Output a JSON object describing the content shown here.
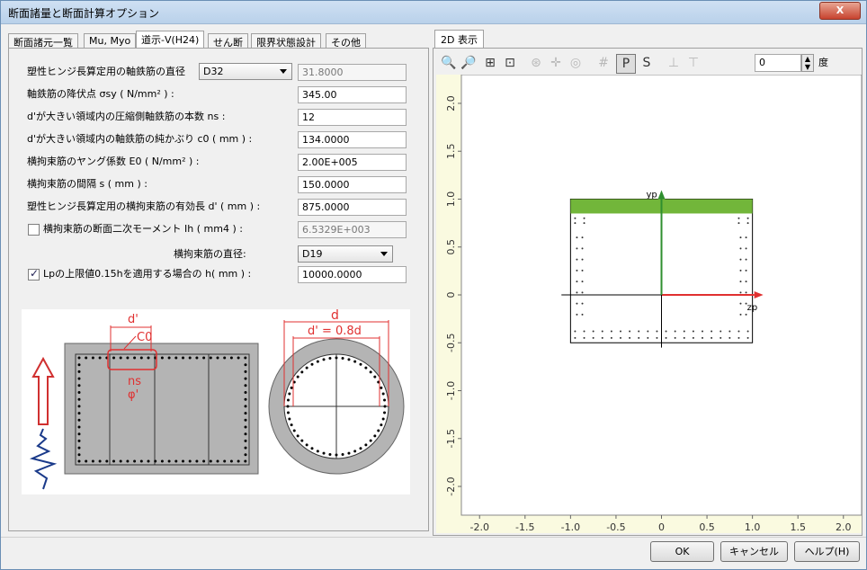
{
  "window": {
    "title": "断面諸量と断面計算オプション",
    "close_label": "X"
  },
  "tabs": [
    "断面諸元一覧",
    "Mu, Myo",
    "道示-V(H24)",
    "せん断",
    "限界状態設計",
    "その他"
  ],
  "form": {
    "rows": [
      {
        "label": "塑性ヒンジ長算定用の軸鉄筋の直径",
        "select": "D32",
        "value": "31.8000"
      },
      {
        "label": "軸鉄筋の降伏点 σsy ( N/mm² ) :",
        "value": "345.00"
      },
      {
        "label": "d'が大きい領域内の圧縮側軸鉄筋の本数 ns :",
        "value": "12"
      },
      {
        "label": "d'が大きい領域内の軸鉄筋の純かぶり c0 ( mm ) :",
        "value": "134.0000"
      },
      {
        "label": "横拘束筋のヤング係数 E0 ( N/mm² ) :",
        "value": "2.00E+005"
      },
      {
        "label": "横拘束筋の間隔 s ( mm ) :",
        "value": "150.0000"
      },
      {
        "label": "塑性ヒンジ長算定用の横拘束筋の有効長 d' ( mm ) :",
        "value": "875.0000"
      },
      {
        "label": "横拘束筋の断面二次モーメント Ih ( mm4 ) :",
        "value": "6.5329E+003"
      },
      {
        "label": "横拘束筋の直径:",
        "select": "D19"
      },
      {
        "label": "Lpの上限値0.15hを適用する場合の h( mm ) :",
        "value": "10000.0000"
      }
    ]
  },
  "diagram": {
    "d_prime": "d'",
    "c0": "C0",
    "ns": "ns",
    "phi": "φ'",
    "d": "d",
    "d_eq": "d' = 0.8d"
  },
  "right": {
    "tab": "2D 表示",
    "angle_value": "0",
    "angle_unit": "度",
    "icons": [
      "zoom-in-icon",
      "zoom-out-icon",
      "fit-icon",
      "frame-icon",
      "pan-icon",
      "move-icon",
      "center-icon",
      "grid-icon",
      "p-icon",
      "s-icon",
      "hatch-icon",
      "hatch2-icon"
    ]
  },
  "chart_data": {
    "type": "scatter",
    "title": "",
    "xlabel": "zp",
    "ylabel": "yp",
    "xlim": [
      -2.2,
      2.2
    ],
    "ylim": [
      -2.3,
      2.3
    ],
    "x_ticks": [
      "-2.0",
      "-1.5",
      "-1.0",
      "-0.5",
      "0",
      "0.5",
      "1.0",
      "1.5",
      "2.0"
    ],
    "y_ticks": [
      "2.0",
      "1.5",
      "1.0",
      "0.5",
      "0",
      "-0.5",
      "-1.0",
      "-1.5",
      "-2.0"
    ],
    "section": {
      "x0": -1.0,
      "x1": 1.0,
      "y0": -0.5,
      "y1": 1.0
    },
    "compression_band": {
      "x0": -1.0,
      "x1": 1.0,
      "y0": 0.85,
      "y1": 1.0
    },
    "colors": {
      "axis_y": "#2f8f2f",
      "axis_z": "#e03030",
      "band": "#72b63a",
      "plot_bg": "#fafae0"
    }
  },
  "buttons": {
    "ok": "OK",
    "cancel": "キャンセル",
    "help": "ヘルプ(H)"
  }
}
